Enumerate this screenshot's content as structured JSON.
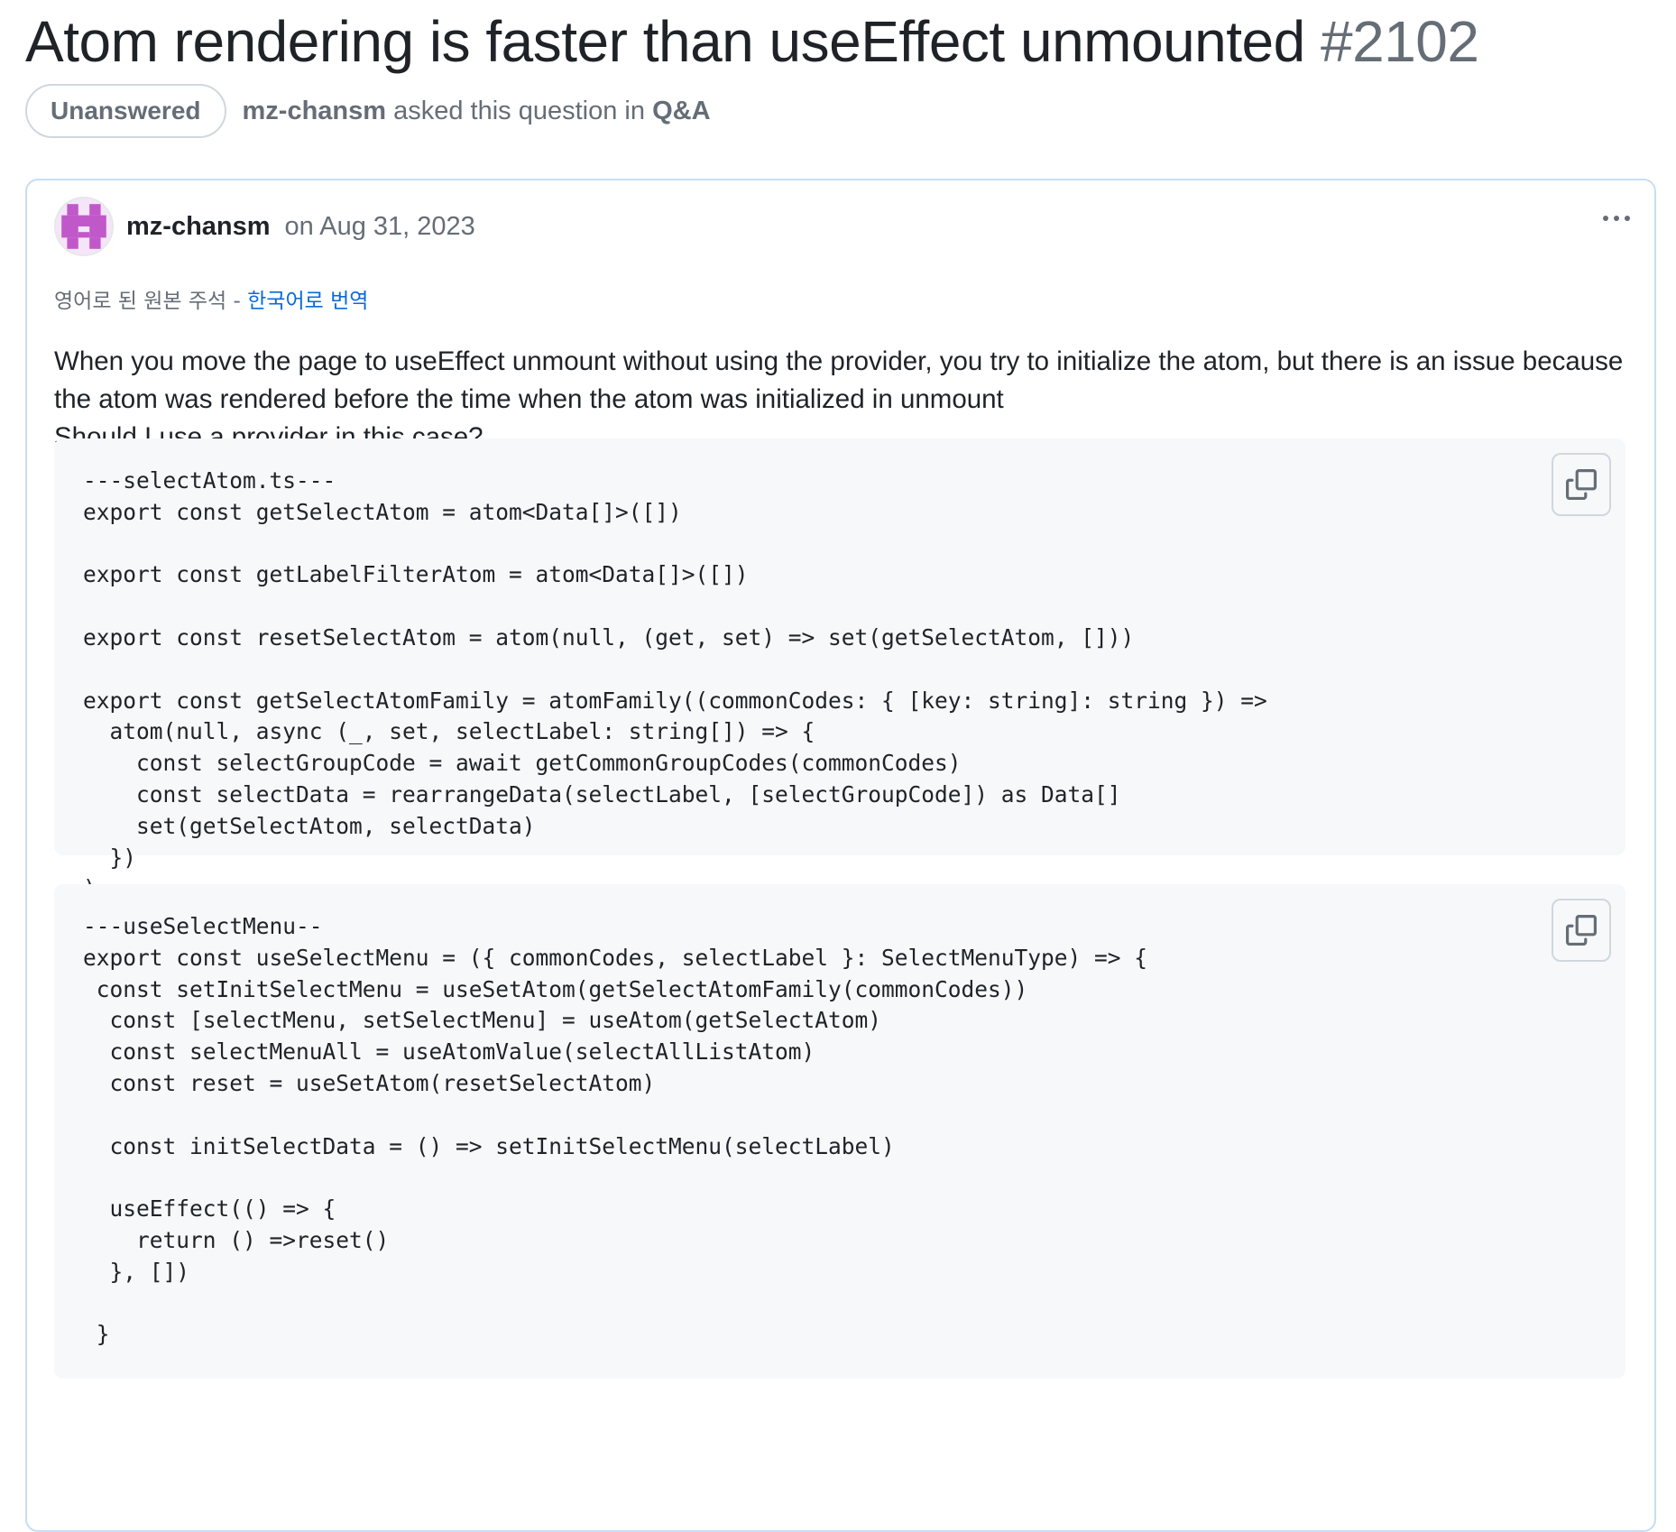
{
  "discussion": {
    "title": "Atom rendering is faster than useEffect unmounted",
    "number": "#2102",
    "state": "Unanswered",
    "author": "mz-chansm",
    "meta_verb": "asked this question in",
    "category": "Q&A"
  },
  "post": {
    "author": "mz-chansm",
    "date": "on Aug 31, 2023",
    "translation": {
      "prefix": "영어로 된 원본 주석 -",
      "link": "한국어로 번역"
    },
    "body_lines": [
      "When you move the page to useEffect unmount without using the provider, you try to initialize the atom, but there is an issue because",
      "the atom was rendered before the time when the atom was initialized in unmount",
      "Should I use a provider in this case?"
    ],
    "code_blocks": [
      {
        "code": "---selectAtom.ts---\nexport const getSelectAtom = atom<Data[]>([])\n\nexport const getLabelFilterAtom = atom<Data[]>([])\n\nexport const resetSelectAtom = atom(null, (get, set) => set(getSelectAtom, []))\n\nexport const getSelectAtomFamily = atomFamily((commonCodes: { [key: string]: string }) =>\n  atom(null, async (_, set, selectLabel: string[]) => {\n    const selectGroupCode = await getCommonGroupCodes(commonCodes)\n    const selectData = rearrangeData(selectLabel, [selectGroupCode]) as Data[]\n    set(getSelectAtom, selectData)\n  })\n)"
      },
      {
        "code": "---useSelectMenu--\nexport const useSelectMenu = ({ commonCodes, selectLabel }: SelectMenuType) => {\n const setInitSelectMenu = useSetAtom(getSelectAtomFamily(commonCodes))\n  const [selectMenu, setSelectMenu] = useAtom(getSelectAtom)\n  const selectMenuAll = useAtomValue(selectAllListAtom)\n  const reset = useSetAtom(resetSelectAtom)\n\n  const initSelectData = () => setInitSelectMenu(selectLabel)\n\n  useEffect(() => {\n    return () =>reset()\n  }, [])\n\n }"
      }
    ]
  },
  "icons": {
    "copy": "copy-icon",
    "more": "kebab-horizontal-icon",
    "avatar": "identicon"
  },
  "colors": {
    "link": "#0969da",
    "muted": "#656d76",
    "card_border": "#c6ddf5",
    "code_bg": "#f6f8fa",
    "avatar": "#c158c9"
  }
}
